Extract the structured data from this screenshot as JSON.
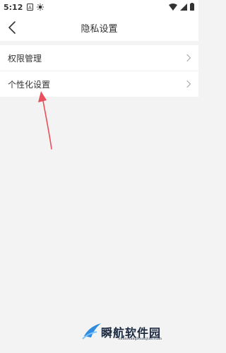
{
  "status_bar": {
    "time": "5:12",
    "icons": [
      "sim-card-icon",
      "brightness-icon",
      "wifi-icon",
      "signal-icon",
      "battery-icon"
    ]
  },
  "header": {
    "title": "隐私设置",
    "back_icon": "chevron-left-icon"
  },
  "settings": {
    "items": [
      {
        "label": "权限管理",
        "icon": "chevron-right-icon"
      },
      {
        "label": "个性化设置",
        "icon": "chevron-right-icon"
      }
    ]
  },
  "annotation": {
    "color": "#e8505b"
  },
  "watermark": {
    "title": "瞬航软件园",
    "subtitle": "ShunHangRuanJianYuan"
  }
}
